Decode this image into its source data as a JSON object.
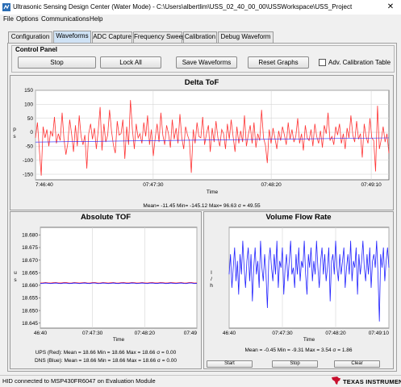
{
  "window": {
    "title": "Ultrasonic Sensing Design Center (Water Mode) - C:\\Users\\albertlim\\USS_02_40_00_00\\USSWorkspace\\USS_Project",
    "close_glyph": "✕"
  },
  "menu": [
    "File",
    "Options",
    "Communications",
    "Help"
  ],
  "tabs": [
    {
      "label": "Configuration",
      "active": false
    },
    {
      "label": "Waveforms",
      "active": true
    },
    {
      "label": "ADC Capture",
      "active": false
    },
    {
      "label": "Frequency Sweep",
      "active": false
    },
    {
      "label": "Calibration",
      "active": false
    },
    {
      "label": "Debug Waveform",
      "active": false
    }
  ],
  "control_panel": {
    "title": "Control Panel",
    "stop_label": "Stop",
    "lock_all_label": "Lock All",
    "save_waveforms_label": "Save Waveforms",
    "reset_graphs_label": "Reset Graphs",
    "adv_calibration_label": "Adv. Calibration Table",
    "adv_calibration_checked": false
  },
  "colors": {
    "red_series": "#ff3333",
    "blue_series": "#2222ff",
    "accent_tab": "#cfe2f5"
  },
  "delta_tof": {
    "stats": "Mean= -11.45 Min= -145.12 Max= 96.63 σ = 49.55"
  },
  "absolute_tof": {
    "stats_ups": "UPS (Red): Mean = 18.66 Min = 18.66 Max = 18.66 σ = 0.00",
    "stats_dns": "DNS (Blue): Mean = 18.66 Min = 18.66 Max = 18.66 σ = 0.00"
  },
  "volume_flow": {
    "stats": "Mean = -0.45 Min = -9.31 Max = 3.54 σ = 1.86",
    "start_label": "Start",
    "stop_label": "Stop",
    "clear_label": "Clear"
  },
  "status": {
    "text": "HID connected to MSP430FR6047 on Evaluation Module",
    "brand": "TEXAS INSTRUMENTS"
  },
  "chart_data": [
    {
      "type": "line",
      "title": "Delta ToF",
      "xlabel": "Time",
      "ylabel": "p s",
      "x_ticks": [
        "7:46:40",
        "07:47:30",
        "07:48:20",
        "07:49:10"
      ],
      "y_ticks": [
        150,
        100,
        50,
        0,
        -50,
        -100,
        -150
      ],
      "ylim": [
        -170,
        150
      ],
      "series": [
        {
          "color": "#ff3333",
          "values": [
            -20,
            35,
            -60,
            -155,
            20,
            -20,
            10,
            -50,
            5,
            -15,
            55,
            -40,
            -5,
            -30,
            70,
            -25,
            -80,
            -40,
            45,
            -5,
            -70,
            25,
            -50,
            60,
            -15,
            -45,
            -10,
            -130,
            -5,
            30,
            -25,
            15,
            -60,
            5,
            90,
            -65,
            30,
            -35,
            -10,
            80,
            5,
            -45,
            -75,
            40,
            -10,
            -5,
            45,
            -95,
            20,
            -45,
            115,
            10,
            -60,
            30,
            -20,
            -5,
            -40,
            35,
            -15,
            60,
            -45,
            10,
            -85,
            -20,
            30,
            -35,
            70,
            -10,
            -45,
            25,
            -5,
            -55,
            45,
            -25,
            15,
            -40,
            65,
            -20,
            -60,
            20,
            -10,
            -30,
            -145,
            10,
            -40,
            35,
            -15,
            -20,
            55,
            -45,
            -5,
            25,
            -70,
            15,
            -35,
            40,
            -20,
            -50,
            10,
            -5,
            -60,
            30,
            -25,
            45,
            -15,
            -70,
            20,
            -40,
            5,
            -35,
            60,
            -50,
            -10,
            25,
            -40,
            35,
            -55,
            -5,
            -30,
            80,
            -20,
            -45,
            -110,
            10,
            -40,
            15,
            -20,
            -60,
            5,
            -30,
            20,
            -10,
            -45,
            35,
            -25,
            10,
            -35,
            -15,
            50,
            -40,
            -5,
            -65,
            25,
            -20,
            -30,
            10,
            -50,
            30,
            -15,
            -40,
            5,
            -55,
            25,
            -5,
            70,
            -30,
            -15,
            -45,
            20,
            -10,
            30,
            -40,
            -5,
            -60,
            15,
            -20,
            60,
            -10,
            -35,
            40,
            -25,
            -5,
            -90,
            30,
            -15,
            -40,
            50,
            -20,
            -30,
            -140,
            95,
            -60,
            -25,
            20,
            -35,
            -5,
            -75
          ]
        },
        {
          "color": "#2222ff",
          "values": [
            -35,
            -20
          ]
        }
      ]
    },
    {
      "type": "line",
      "title": "Absolute TOF",
      "xlabel": "Time",
      "ylabel": "u s",
      "x_ticks": [
        "46:40",
        "07:47:30",
        "07:48:20",
        "07:49"
      ],
      "y_ticks": [
        "18.680",
        "18.675",
        "18.670",
        "18.665",
        "18.660",
        "18.655",
        "18.650",
        "18.645"
      ],
      "ylim": [
        18.643,
        18.683
      ],
      "series": [
        {
          "name": "UPS (Red)",
          "color": "#ff3333",
          "level": 18.661
        },
        {
          "name": "DNS (Blue)",
          "color": "#2222ff",
          "level": 18.6608
        }
      ]
    },
    {
      "type": "line",
      "title": "Volume Flow Rate",
      "xlabel": "Time",
      "ylabel": "l / h",
      "x_ticks": [
        "46:40",
        "07:47:30",
        "07:48:20",
        "07:49:10"
      ],
      "ylim": [
        -10,
        5
      ],
      "series": [
        {
          "color": "#2222ff",
          "values": [
            -2,
            1,
            -4,
            -1,
            2,
            -3,
            0,
            -5,
            1,
            -2,
            3,
            -1,
            -4,
            0,
            2,
            -3,
            1,
            -6,
            -1,
            2,
            -2,
            0,
            -4,
            3,
            -1,
            -3,
            1,
            -2,
            -7,
            0,
            2,
            -1,
            -3,
            1,
            -2,
            3,
            -4,
            0,
            -1,
            2,
            -5,
            -1,
            1,
            -3,
            0,
            3,
            -2,
            -1,
            -4,
            1,
            -2,
            2,
            -3,
            0,
            -1,
            3,
            -2,
            -5,
            1,
            -1,
            2,
            -3,
            0,
            -2,
            3,
            -1,
            -4,
            0,
            2,
            -2,
            1,
            -3,
            -1,
            2,
            -6,
            0,
            1,
            -2,
            3,
            -1,
            -3,
            1,
            -2,
            0,
            2,
            -4,
            -1,
            1,
            -2,
            3,
            -3,
            0,
            -1,
            2,
            -5,
            1,
            -2,
            0,
            3,
            -1,
            -3,
            1,
            -2,
            2,
            -4,
            0,
            1,
            -1,
            3,
            -2,
            -9,
            1,
            -1,
            2,
            -3,
            0,
            2,
            -1
          ]
        }
      ]
    }
  ]
}
